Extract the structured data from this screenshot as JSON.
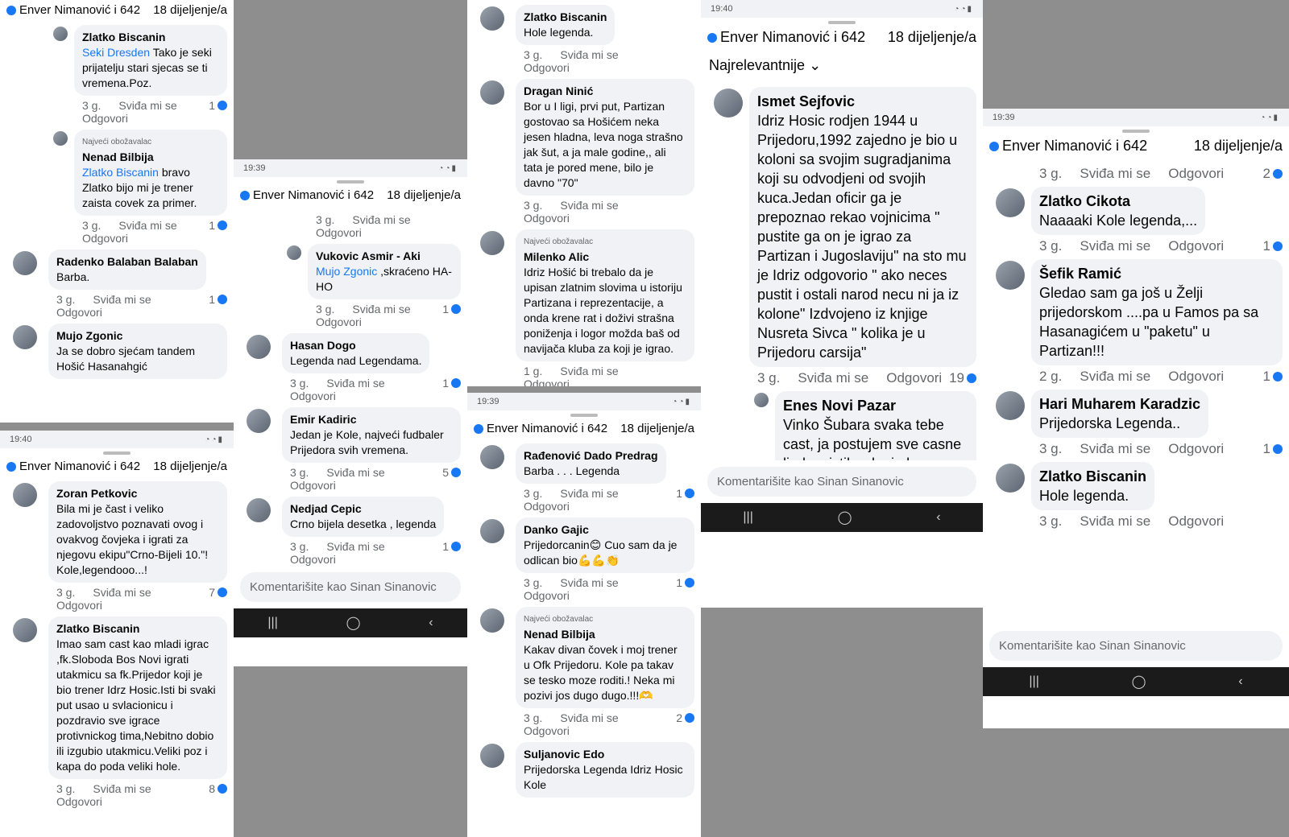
{
  "header": {
    "title": "Enver Nimanović i 642",
    "shares": "18 dijeljenje/a"
  },
  "status_times": {
    "t1": "19:40",
    "t2": "19:39"
  },
  "composer_placeholder": "Komentarišite kao Sinan Sinanovic",
  "sort_label": "Najrelevantnije",
  "actions": {
    "like": "Sviđa mi se",
    "reply": "Odgovori"
  },
  "badge": "Najveći obožavalac",
  "col1": [
    {
      "name": "Zlatko Biscanin",
      "tag": "Seki Dresden",
      "text": "Tako je seki prijatelju stari sjecas se ti vremena.Poz.",
      "time": "3 g.",
      "react": "1",
      "reply": true
    },
    {
      "name": "Nenad Bilbija",
      "badge": true,
      "tag": "Zlatko Biscanin",
      "text": "bravo Zlatko bijo mi je trener zaista covek za primer.",
      "time": "3 g.",
      "react": "1",
      "reply": true
    },
    {
      "name": "Radenko Balaban Balaban",
      "text": "Barba.",
      "time": "3 g.",
      "react": "1"
    },
    {
      "name": "Mujo Zgonic",
      "text": "Ja se dobro sjećam tandem Hošić Hasanahgić",
      "time": "",
      "react": ""
    }
  ],
  "col1b": [
    {
      "name": "Zoran Petkovic",
      "text": "Bila mi je čast i veliko zadovoljstvo poznavati ovog i ovakvog čovjeka i igrati za njegovu ekipu\"Crno-Bijeli 10.\"! Kole,legendooo...!",
      "time": "3 g.",
      "react": "7"
    },
    {
      "name": "Zlatko Biscanin",
      "text": "Imao sam cast kao mladi igrac ,fk.Sloboda Bos Novi igrati utakmicu sa fk.Prijedor koji je bio trener Idrz Hosic.Isti bi svaki put usao u svlacionicu i pozdravio sve igrace protivnickog tima,Nebitno dobio ili izgubio utakmicu.Veliki poz i kapa do poda veliki hole.",
      "time": "3 g.",
      "react": "8"
    }
  ],
  "col2": [
    {
      "name": "",
      "text": "",
      "time": "3 g.",
      "react": "",
      "metaOnly": true,
      "reply": true
    },
    {
      "name": "Vukovic Asmir - Aki",
      "tag": "Mujo Zgonic",
      "text": ",skraćeno HA-HO",
      "time": "3 g.",
      "react": "1",
      "reply": true
    },
    {
      "name": "Hasan Dogo",
      "text": "Legenda nad Legendama.",
      "time": "3 g.",
      "react": "1"
    },
    {
      "name": "Emir Kadiric",
      "text": "Jedan je Kole, najveći fudbaler Prijedora svih vremena.",
      "time": "3 g.",
      "react": "5"
    },
    {
      "name": "Nedjad Cepic",
      "text": "Crno bijela desetka , legenda",
      "time": "3 g.",
      "react": "1"
    }
  ],
  "col3": [
    {
      "name": "Zlatko Biscanin",
      "text": "Hole legenda.",
      "time": "3 g.",
      "react": ""
    },
    {
      "name": "Dragan Ninić",
      "text": "Bor u I ligi, prvi put, Partizan gostovao sa Hošićem neka jesen hladna, leva noga strašno jak šut, a ja male godine,, ali tata je pored mene, bilo je davno \"70\"",
      "time": "3 g.",
      "react": ""
    },
    {
      "name": "Milenko Alic",
      "badge": true,
      "text": "Idriz Hošić bi trebalo da je upisan zlatnim slovima u istoriju Partizana i reprezentacije, a onda krene rat i doživi strašna poniženja i logor možda baš od navijača kluba za koji je igrao.",
      "time": "1 g.",
      "react": ""
    }
  ],
  "col3b": [
    {
      "name": "Rađenović Dado Predrag",
      "text": "Barba . . . Legenda",
      "time": "3 g.",
      "react": "1"
    },
    {
      "name": "Danko Gajic",
      "text": "Prijedorcanin😊 Cuo sam da je odlican bio💪💪👏",
      "time": "3 g.",
      "react": "1"
    },
    {
      "name": "Nenad Bilbija",
      "badge": true,
      "text": "Kakav divan čovek i moj trener u Ofk Prijedoru. Kole pa takav se tesko moze roditi.! Neka mi pozivi jos dugo dugo.!!!🫶",
      "time": "3 g.",
      "react": "2"
    },
    {
      "name": "Suljanovic Edo",
      "text": "Prijedorska Legenda Idriz Hosic Kole",
      "time": "",
      "react": ""
    }
  ],
  "col4": [
    {
      "name": "Ismet Sejfovic",
      "text": "Idriz Hosic rodjen 1944 u Prijedoru,1992 zajedno je bio u koloni sa svojim sugradjanima koji su odvodjeni od svojih kuca.Jedan oficir ga je prepoznao rekao vojnicima \" pustite ga on je igrao za Partizan i Jugoslaviju\" na sto mu je Idriz odgovorio \" ako neces pustit i ostali narod necu ni ja iz kolone\" Izdvojeno iz knjige Nusreta Sivca \" kolika je u Prijedoru carsija\"",
      "time": "3 g.",
      "react": "19"
    },
    {
      "name": "Enes Novi Pazar",
      "text": "Vinko Šubara svaka tebe cast, ja postujem sve casne ljude, cistih ruku i obraza. Bitno je da su ljudi bilo koje",
      "time": "",
      "react": "",
      "reply": true
    }
  ],
  "col5": [
    {
      "name": "",
      "text": "",
      "time": "3 g.",
      "react": "2",
      "metaOnly": true
    },
    {
      "name": "Zlatko Cikota",
      "text": "Naaaaki Kole legenda,...",
      "time": "3 g.",
      "react": "1"
    },
    {
      "name": "Šefik Ramić",
      "text": "Gledao sam ga još u Želji prijedorskom ....pa u Famos pa sa Hasanagićem u \"paketu\" u Partizan!!!",
      "time": "2 g.",
      "react": "1"
    },
    {
      "name": "Hari Muharem Karadzic",
      "text": "Prijedorska Legenda..",
      "time": "3 g.",
      "react": "1"
    },
    {
      "name": "Zlatko Biscanin",
      "text": "Hole legenda.",
      "time": "3 g.",
      "react": ""
    }
  ]
}
